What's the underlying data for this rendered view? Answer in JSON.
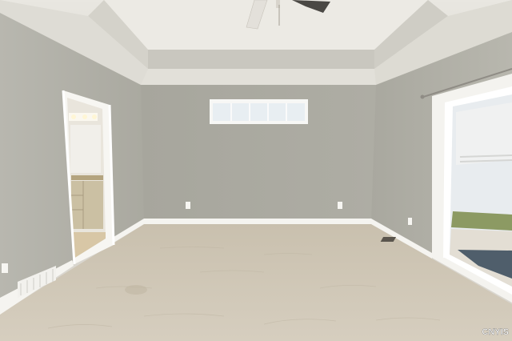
{
  "photo": {
    "watermark": "CNYIS",
    "colors": {
      "ceiling": "#e6e4dd",
      "wall_back": "#aaa9a0",
      "wall_left": "#b3b2a9",
      "wall_right": "#b0afa6",
      "carpet": "#cfc6b4",
      "trim": "#ffffff",
      "glass": "#e7ecef"
    }
  }
}
